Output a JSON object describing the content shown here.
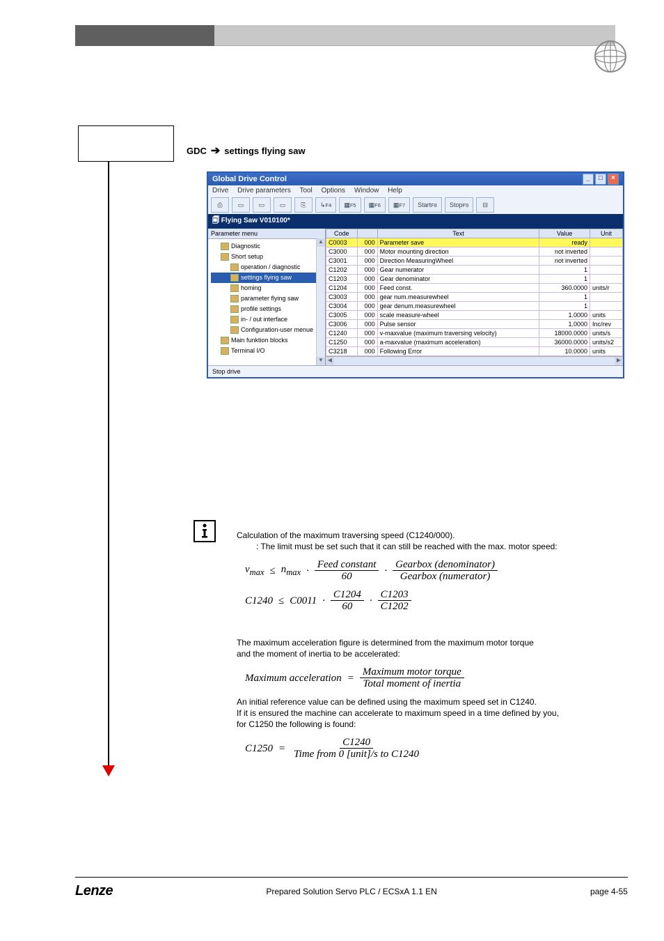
{
  "sidebox": {
    "label": ""
  },
  "caption": {
    "text": "settings flying saw"
  },
  "gdc": {
    "title": "Global Drive Control",
    "menu": [
      "Drive",
      "Drive parameters",
      "Tool",
      "Options",
      "Window",
      "Help"
    ],
    "toolbar_text": {
      "start": "Start",
      "stop": "Stop",
      "f4": "F4",
      "f5": "F5",
      "f6": "F6",
      "f7": "F7",
      "f8": "F8",
      "f9": "F9"
    },
    "strip": "Flying Saw V010100*",
    "tree_header": "Parameter menu",
    "tree": [
      {
        "label": "Diagnostic",
        "indent": 1,
        "sel": false
      },
      {
        "label": "Short setup",
        "indent": 1,
        "sel": false
      },
      {
        "label": "operation / diagnostic",
        "indent": 2,
        "sel": false
      },
      {
        "label": "settings flying saw",
        "indent": 2,
        "sel": true
      },
      {
        "label": "homing",
        "indent": 2,
        "sel": false
      },
      {
        "label": "parameter flying saw",
        "indent": 2,
        "sel": false
      },
      {
        "label": "profile settings",
        "indent": 2,
        "sel": false
      },
      {
        "label": "in- / out interface",
        "indent": 2,
        "sel": false
      },
      {
        "label": "Configuration-user menue",
        "indent": 2,
        "sel": false
      },
      {
        "label": "Main funktion blocks",
        "indent": 1,
        "sel": false
      },
      {
        "label": "Terminal I/O",
        "indent": 1,
        "sel": false
      }
    ],
    "grid_headers": {
      "code": "Code",
      "sub": "",
      "text": "Text",
      "value": "Value",
      "unit": "Unit"
    },
    "rows": [
      {
        "code": "C0003",
        "sub": "000",
        "text": "Parameter save",
        "value": "ready",
        "unit": "",
        "hl": true
      },
      {
        "code": "C3000",
        "sub": "000",
        "text": "Motor mounting direction",
        "value": "not inverted",
        "unit": ""
      },
      {
        "code": "C3001",
        "sub": "000",
        "text": "Direction MeasuringWheel",
        "value": "not inverted",
        "unit": ""
      },
      {
        "code": "C1202",
        "sub": "000",
        "text": "Gear numerator",
        "value": "1",
        "unit": ""
      },
      {
        "code": "C1203",
        "sub": "000",
        "text": "Gear denominator",
        "value": "1",
        "unit": ""
      },
      {
        "code": "C1204",
        "sub": "000",
        "text": "Feed const.",
        "value": "360.0000",
        "unit": "units/r"
      },
      {
        "code": "C3003",
        "sub": "000",
        "text": "gear num.measurewheel",
        "value": "1",
        "unit": ""
      },
      {
        "code": "C3004",
        "sub": "000",
        "text": "gear denum.measurewheel",
        "value": "1",
        "unit": ""
      },
      {
        "code": "C3005",
        "sub": "000",
        "text": "scale measure-wheel",
        "value": "1.0000",
        "unit": "units"
      },
      {
        "code": "C3006",
        "sub": "000",
        "text": "Pulse sensor",
        "value": "1.0000",
        "unit": "Inc/rev"
      },
      {
        "code": "C1240",
        "sub": "000",
        "text": "v-maxvalue (maximum traversing velocity)",
        "value": "18000.0000",
        "unit": "units/s"
      },
      {
        "code": "C1250",
        "sub": "000",
        "text": "a-maxvalue (maximum acceleration)",
        "value": "36000.0000",
        "unit": "units/s2"
      },
      {
        "code": "C3218",
        "sub": "000",
        "text": "Following Error",
        "value": "10.0000",
        "unit": "units"
      }
    ],
    "status": "Stop drive"
  },
  "info": {
    "line1": "Calculation of the maximum traversing speed (C1240/000).",
    "line2": ": The limit must be set such that it can still be reached with the max. motor speed:",
    "formula1": {
      "lhs": "v",
      "lhs_sub": "max",
      "op": "≤",
      "r1": "n",
      "r1_sub": "max",
      "mul": "·",
      "f1_num": "Feed constant",
      "f1_den": "60",
      "f2_num": "Gearbox (denominator)",
      "f2_den": "Gearbox (numerator)"
    },
    "formula2": {
      "lhs": "C1240",
      "op": "≤",
      "r1": "C0011",
      "mul": "·",
      "f1_num": "C1204",
      "f1_den": "60",
      "f2_num": "C1203",
      "f2_den": "C1202"
    },
    "para2a": "The maximum acceleration figure is determined from the maximum motor torque",
    "para2b": "and the moment of inertia to be accelerated:",
    "formula3": {
      "lhs": "Maximum acceleration",
      "eq": "=",
      "num": "Maximum motor torque",
      "den": "Total moment of inertia"
    },
    "para3a": "An initial reference value can be defined using the maximum speed set in C1240.",
    "para3b": "If it is ensured the machine can accelerate to maximum speed in a time defined by you,",
    "para3c": "for C1250 the following is found:",
    "formula4": {
      "lhs": "C1250",
      "eq": "=",
      "num": "C1240",
      "den": "Time from 0 [unit]/s to C1240"
    }
  },
  "footer": {
    "logo": "Lenze",
    "mid": "Prepared Solution Servo PLC / ECSxA 1.1 EN",
    "page": "page 4-55"
  }
}
